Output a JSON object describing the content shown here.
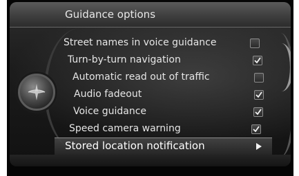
{
  "header": {
    "title": "Guidance options"
  },
  "menu": {
    "items": [
      {
        "label": "Street names in voice guidance",
        "checked": false
      },
      {
        "label": "Turn-by-turn navigation",
        "checked": true
      },
      {
        "label": "Automatic read out of traffic",
        "checked": false
      },
      {
        "label": "Audio fadeout",
        "checked": true
      },
      {
        "label": "Voice guidance",
        "checked": true
      },
      {
        "label": "Speed camera warning",
        "checked": true
      },
      {
        "label": "Stored location notification",
        "submenu": true,
        "selected": true
      }
    ]
  },
  "icons": {
    "knob": "navigation-knob-icon",
    "check": "checkmark-icon",
    "submenu": "play-arrow-icon"
  }
}
